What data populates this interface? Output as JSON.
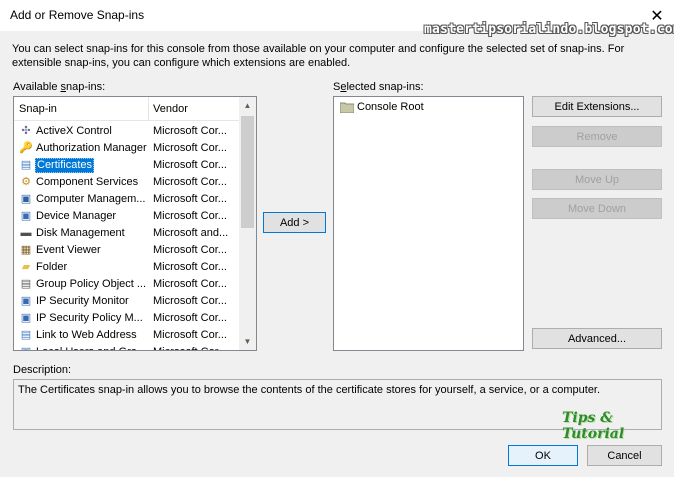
{
  "window": {
    "title": "Add or Remove Snap-ins",
    "close_glyph": "✕"
  },
  "watermark": "mastertipsorialindo.blogspot.com",
  "intro_text": "You can select snap-ins for this console from those available on your computer and configure the selected set of snap-ins. For extensible snap-ins, you can configure which extensions are enabled.",
  "available": {
    "label_prefix": "Available ",
    "label_underlined": "s",
    "label_suffix": "nap-ins:",
    "col_snapin": "Snap-in",
    "col_vendor": "Vendor",
    "selected_index": 2,
    "items": [
      {
        "name": "ActiveX Control",
        "vendor": "Microsoft Cor...",
        "icon": "activex-icon",
        "glyph": "✣",
        "color": "#6a6aa0"
      },
      {
        "name": "Authorization Manager",
        "vendor": "Microsoft Cor...",
        "icon": "authorization-manager-icon",
        "glyph": "🔑",
        "color": "#b08a20"
      },
      {
        "name": "Certificates",
        "vendor": "Microsoft Cor...",
        "icon": "certificates-icon",
        "glyph": "▤",
        "color": "#4a7fc0"
      },
      {
        "name": "Component Services",
        "vendor": "Microsoft Cor...",
        "icon": "component-services-icon",
        "glyph": "⚙",
        "color": "#c09020"
      },
      {
        "name": "Computer Managem...",
        "vendor": "Microsoft Cor...",
        "icon": "computer-management-icon",
        "glyph": "▣",
        "color": "#3060a0"
      },
      {
        "name": "Device Manager",
        "vendor": "Microsoft Cor...",
        "icon": "device-manager-icon",
        "glyph": "▣",
        "color": "#3a6ab0"
      },
      {
        "name": "Disk Management",
        "vendor": "Microsoft and...",
        "icon": "disk-management-icon",
        "glyph": "▬",
        "color": "#505050"
      },
      {
        "name": "Event Viewer",
        "vendor": "Microsoft Cor...",
        "icon": "event-viewer-icon",
        "glyph": "▦",
        "color": "#806020"
      },
      {
        "name": "Folder",
        "vendor": "Microsoft Cor...",
        "icon": "folder-icon",
        "glyph": "▰",
        "color": "#e8c050"
      },
      {
        "name": "Group Policy Object ...",
        "vendor": "Microsoft Cor...",
        "icon": "group-policy-icon",
        "glyph": "▤",
        "color": "#606060"
      },
      {
        "name": "IP Security Monitor",
        "vendor": "Microsoft Cor...",
        "icon": "ip-security-monitor-icon",
        "glyph": "▣",
        "color": "#3a6ab0"
      },
      {
        "name": "IP Security Policy M...",
        "vendor": "Microsoft Cor...",
        "icon": "ip-security-policy-icon",
        "glyph": "▣",
        "color": "#3a6ab0"
      },
      {
        "name": "Link to Web Address",
        "vendor": "Microsoft Cor...",
        "icon": "web-link-icon",
        "glyph": "▤",
        "color": "#4a7fc0"
      },
      {
        "name": "Local Users and Gro...",
        "vendor": "Microsoft Cor...",
        "icon": "local-users-icon",
        "glyph": "▣",
        "color": "#3a6ab0"
      }
    ]
  },
  "add_button": "Add >",
  "selected": {
    "label_prefix": "S",
    "label_underlined": "e",
    "label_suffix": "lected snap-ins:",
    "items": [
      {
        "name": "Console Root",
        "icon": "folder-icon"
      }
    ]
  },
  "side_buttons": {
    "edit_extensions": "Edit Extensions...",
    "remove": "Remove",
    "move_up": "Move Up",
    "move_down": "Move Down",
    "advanced": "Advanced..."
  },
  "description": {
    "label": "Description:",
    "text": "The Certificates snap-in allows you to browse the contents of the certificate stores for yourself, a service, or a computer."
  },
  "tips_logo": "Tips & Tutorial",
  "footer": {
    "ok": "OK",
    "cancel": "Cancel"
  },
  "colors": {
    "selection": "#0078d7",
    "dialog_bg": "#f0f0f0"
  }
}
